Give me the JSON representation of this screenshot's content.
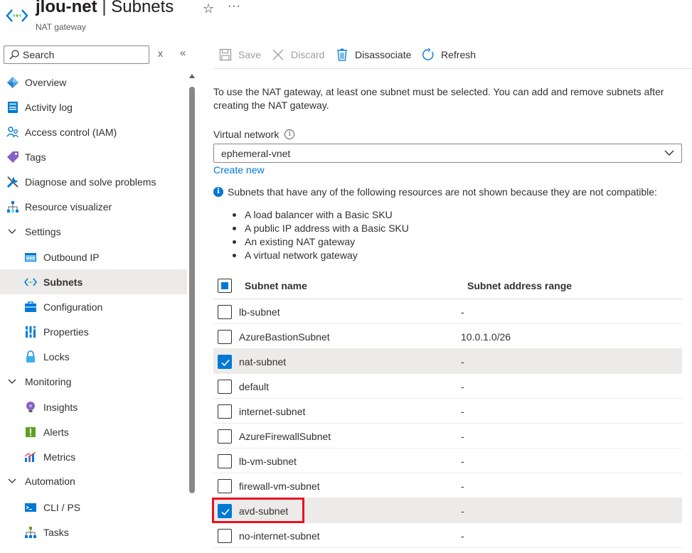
{
  "header": {
    "resource_name": "jlou-net",
    "separator": " | ",
    "page_name": "Subnets",
    "subtitle": "NAT gateway",
    "favorite_icon": "star-icon",
    "more_icon": "ellipsis-icon",
    "more_label": "···"
  },
  "sidebar": {
    "search_placeholder": "Search",
    "clear_label": "x",
    "collapse_label": "«",
    "items": [
      {
        "label": "Overview",
        "icon": "overview-icon",
        "level": 0,
        "type": "item"
      },
      {
        "label": "Activity log",
        "icon": "activity-log-icon",
        "level": 0,
        "type": "item"
      },
      {
        "label": "Access control (IAM)",
        "icon": "iam-icon",
        "level": 0,
        "type": "item"
      },
      {
        "label": "Tags",
        "icon": "tag-icon",
        "level": 0,
        "type": "item"
      },
      {
        "label": "Diagnose and solve problems",
        "icon": "wrench-icon",
        "level": 0,
        "type": "item"
      },
      {
        "label": "Resource visualizer",
        "icon": "visualizer-icon",
        "level": 0,
        "type": "item"
      },
      {
        "label": "Settings",
        "icon": "chevron-down-icon",
        "level": 0,
        "type": "group"
      },
      {
        "label": "Outbound IP",
        "icon": "outbound-ip-icon",
        "level": 1,
        "type": "item"
      },
      {
        "label": "Subnets",
        "icon": "subnets-icon",
        "level": 1,
        "type": "item",
        "selected": true
      },
      {
        "label": "Configuration",
        "icon": "configuration-icon",
        "level": 1,
        "type": "item"
      },
      {
        "label": "Properties",
        "icon": "properties-icon",
        "level": 1,
        "type": "item"
      },
      {
        "label": "Locks",
        "icon": "lock-icon",
        "level": 1,
        "type": "item"
      },
      {
        "label": "Monitoring",
        "icon": "chevron-down-icon",
        "level": 0,
        "type": "group"
      },
      {
        "label": "Insights",
        "icon": "insights-icon",
        "level": 1,
        "type": "item"
      },
      {
        "label": "Alerts",
        "icon": "alerts-icon",
        "level": 1,
        "type": "item"
      },
      {
        "label": "Metrics",
        "icon": "metrics-icon",
        "level": 1,
        "type": "item"
      },
      {
        "label": "Automation",
        "icon": "chevron-down-icon",
        "level": 0,
        "type": "group"
      },
      {
        "label": "CLI / PS",
        "icon": "cli-icon",
        "level": 1,
        "type": "item"
      },
      {
        "label": "Tasks",
        "icon": "tasks-icon",
        "level": 1,
        "type": "item"
      }
    ]
  },
  "toolbar": {
    "save_label": "Save",
    "discard_label": "Discard",
    "disassociate_label": "Disassociate",
    "refresh_label": "Refresh"
  },
  "content": {
    "intro": "To use the NAT gateway, at least one subnet must be selected. You can add and remove subnets after creating the NAT gateway.",
    "vnet_label": "Virtual network",
    "vnet_info": "i",
    "vnet_value": "ephemeral-vnet",
    "create_new": "Create new",
    "info_glyph": "i",
    "note": "Subnets that have any of the following resources are not shown because they are not compatible:",
    "bullets": [
      "A load balancer with a Basic SKU",
      "A public IP address with a Basic SKU",
      "An existing NAT gateway",
      "A virtual network gateway"
    ]
  },
  "table": {
    "columns": [
      "Subnet name",
      "Subnet address range"
    ],
    "header_checkbox": "partial",
    "rows": [
      {
        "name": "lb-subnet",
        "range": "-",
        "checked": false
      },
      {
        "name": "AzureBastionSubnet",
        "range": "10.0.1.0/26",
        "checked": false
      },
      {
        "name": "nat-subnet",
        "range": "-",
        "checked": true
      },
      {
        "name": "default",
        "range": "-",
        "checked": false
      },
      {
        "name": "internet-subnet",
        "range": "-",
        "checked": false
      },
      {
        "name": "AzureFirewallSubnet",
        "range": "-",
        "checked": false
      },
      {
        "name": "lb-vm-subnet",
        "range": "-",
        "checked": false
      },
      {
        "name": "firewall-vm-subnet",
        "range": "-",
        "checked": false
      },
      {
        "name": "avd-subnet",
        "range": "-",
        "checked": true,
        "highlighted": true
      },
      {
        "name": "no-internet-subnet",
        "range": "-",
        "checked": false
      }
    ]
  },
  "colors": {
    "accent": "#0078d4",
    "highlight_border": "#e81123",
    "selected_bg": "#edebe9"
  }
}
